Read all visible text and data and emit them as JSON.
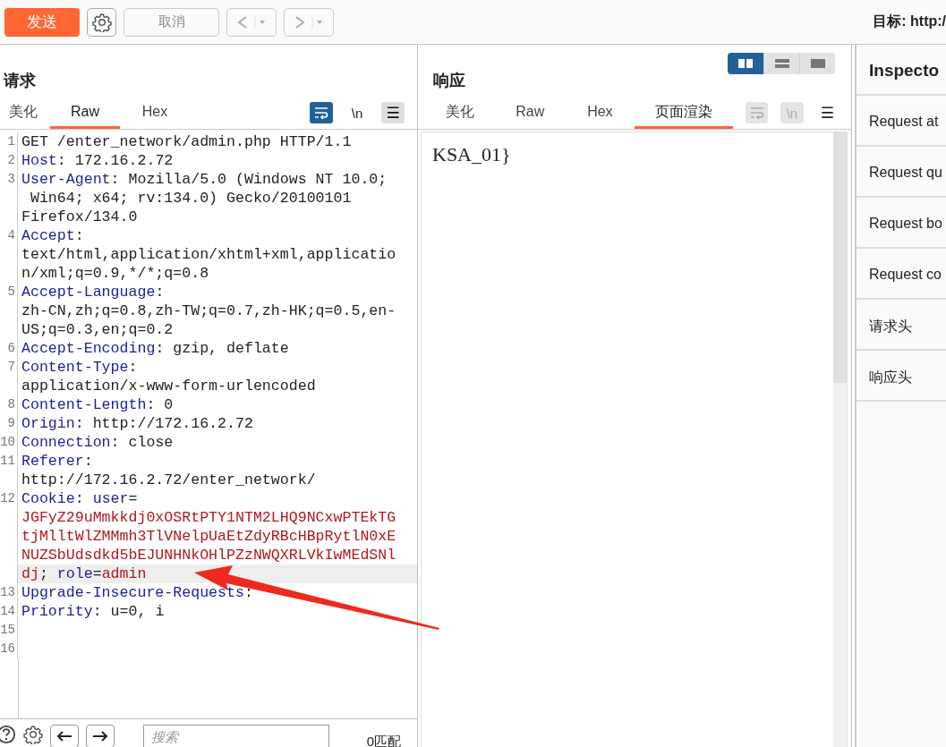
{
  "toolbar": {
    "send_button": "发送",
    "cancel_button": "取消",
    "target": "目标: http:/"
  },
  "request": {
    "title": "请求",
    "tabs": [
      {
        "label": "美化",
        "selected": false
      },
      {
        "label": "Raw",
        "selected": true
      },
      {
        "label": "Hex",
        "selected": false
      }
    ],
    "tools": [
      {
        "kind": "wrap",
        "on": true
      },
      {
        "kind": "newline",
        "text": "\\n",
        "on": false
      },
      {
        "kind": "menu",
        "text": "☰",
        "on": true
      }
    ],
    "lines": [
      {
        "number": "1",
        "rows": [
          {
            "highlighted": false,
            "spans": [
              {
                "kind": "plain",
                "text": "GET /enter_network/admin.php HTTP/1.1"
              }
            ]
          }
        ]
      },
      {
        "number": "2",
        "rows": [
          {
            "highlighted": false,
            "spans": [
              {
                "kind": "key",
                "text": "Host"
              },
              {
                "kind": "plain",
                "text": ": 172.16.2.72"
              }
            ]
          }
        ]
      },
      {
        "number": "3",
        "rows": [
          {
            "highlighted": false,
            "spans": [
              {
                "kind": "key",
                "text": "User-Agent"
              },
              {
                "kind": "plain",
                "text": ": Mozilla/5.0 (Windows NT 10.0;"
              }
            ]
          },
          {
            "highlighted": false,
            "spans": [
              {
                "kind": "plain",
                "text": " Win64; x64; rv:134.0) Gecko/20100101"
              }
            ]
          },
          {
            "highlighted": false,
            "spans": [
              {
                "kind": "plain",
                "text": "Firefox/134.0"
              }
            ]
          }
        ]
      },
      {
        "number": "4",
        "rows": [
          {
            "highlighted": false,
            "spans": [
              {
                "kind": "key",
                "text": "Accept"
              },
              {
                "kind": "plain",
                "text": ":"
              }
            ]
          },
          {
            "highlighted": false,
            "spans": [
              {
                "kind": "plain",
                "text": "text/html,application/xhtml+xml,applicatio"
              }
            ]
          },
          {
            "highlighted": false,
            "spans": [
              {
                "kind": "plain",
                "text": "n/xml;q=0.9,*/*;q=0.8"
              }
            ]
          }
        ]
      },
      {
        "number": "5",
        "rows": [
          {
            "highlighted": false,
            "spans": [
              {
                "kind": "key",
                "text": "Accept-Language"
              },
              {
                "kind": "plain",
                "text": ":"
              }
            ]
          },
          {
            "highlighted": false,
            "spans": [
              {
                "kind": "plain",
                "text": "zh-CN,zh;q=0.8,zh-TW;q=0.7,zh-HK;q=0.5,en-"
              }
            ]
          },
          {
            "highlighted": false,
            "spans": [
              {
                "kind": "plain",
                "text": "US;q=0.3,en;q=0.2"
              }
            ]
          }
        ]
      },
      {
        "number": "6",
        "rows": [
          {
            "highlighted": false,
            "spans": [
              {
                "kind": "key",
                "text": "Accept-Encoding"
              },
              {
                "kind": "plain",
                "text": ": gzip, deflate"
              }
            ]
          }
        ]
      },
      {
        "number": "7",
        "rows": [
          {
            "highlighted": false,
            "spans": [
              {
                "kind": "key",
                "text": "Content-Type"
              },
              {
                "kind": "plain",
                "text": ":"
              }
            ]
          },
          {
            "highlighted": false,
            "spans": [
              {
                "kind": "plain",
                "text": "application/x-www-form-urlencoded"
              }
            ]
          }
        ]
      },
      {
        "number": "8",
        "rows": [
          {
            "highlighted": false,
            "spans": [
              {
                "kind": "key",
                "text": "Content-Length"
              },
              {
                "kind": "plain",
                "text": ": 0"
              }
            ]
          }
        ]
      },
      {
        "number": "9",
        "rows": [
          {
            "highlighted": false,
            "spans": [
              {
                "kind": "key",
                "text": "Origin"
              },
              {
                "kind": "plain",
                "text": ": http://172.16.2.72"
              }
            ]
          }
        ]
      },
      {
        "number": "10",
        "rows": [
          {
            "highlighted": false,
            "spans": [
              {
                "kind": "key",
                "text": "Connection"
              },
              {
                "kind": "plain",
                "text": ": close"
              }
            ]
          }
        ]
      },
      {
        "number": "11",
        "rows": [
          {
            "highlighted": false,
            "spans": [
              {
                "kind": "key",
                "text": "Referer"
              },
              {
                "kind": "plain",
                "text": ":"
              }
            ]
          },
          {
            "highlighted": false,
            "spans": [
              {
                "kind": "plain",
                "text": "http://172.16.2.72/enter_network/"
              }
            ]
          }
        ]
      },
      {
        "number": "12",
        "rows": [
          {
            "highlighted": false,
            "spans": [
              {
                "kind": "key",
                "text": "Cookie"
              },
              {
                "kind": "plain",
                "text": ": "
              },
              {
                "kind": "key",
                "text": "user"
              },
              {
                "kind": "plain",
                "text": "="
              }
            ]
          },
          {
            "highlighted": false,
            "spans": [
              {
                "kind": "cookie",
                "text": "JGFyZ29uMmkkdj0xOSRtPTY1NTM2LHQ9NCxwPTEkTG"
              }
            ]
          },
          {
            "highlighted": false,
            "spans": [
              {
                "kind": "cookie",
                "text": "tjMlltWlZMMmh3TlVNelpUaEtZdyRBcHBpRytlN0xE"
              }
            ]
          },
          {
            "highlighted": false,
            "spans": [
              {
                "kind": "cookie",
                "text": "NUZSbUdsdkd5bEJUNHNkOHlPZzNWQXRLVkIwMEdSNl"
              }
            ]
          },
          {
            "highlighted": true,
            "spans": [
              {
                "kind": "cookie",
                "text": "dj"
              },
              {
                "kind": "plain",
                "text": "; "
              },
              {
                "kind": "key",
                "text": "role"
              },
              {
                "kind": "plain",
                "text": "="
              },
              {
                "kind": "cookie",
                "text": "admin"
              }
            ]
          }
        ]
      },
      {
        "number": "13",
        "rows": [
          {
            "highlighted": false,
            "spans": [
              {
                "kind": "key",
                "text": "Upgrade-Insecure-Requests"
              },
              {
                "kind": "plain",
                "text": ":"
              }
            ]
          }
        ]
      },
      {
        "number": "14",
        "rows": [
          {
            "highlighted": false,
            "spans": [
              {
                "kind": "key",
                "text": "Priority"
              },
              {
                "kind": "plain",
                "text": ": u=0, i"
              }
            ]
          }
        ]
      },
      {
        "number": "15"
      },
      {
        "number": "16"
      }
    ],
    "search": {
      "placeholder": "搜索"
    },
    "match_count": "0匹配"
  },
  "response": {
    "title": "响应",
    "views": [
      {
        "kind": "split",
        "selected": true
      },
      {
        "kind": "stacked",
        "selected": false
      },
      {
        "kind": "single",
        "selected": false
      }
    ],
    "tabs": [
      {
        "label": "美化",
        "selected": false
      },
      {
        "label": "Raw",
        "selected": false
      },
      {
        "label": "Hex",
        "selected": false
      },
      {
        "label": "页面渲染",
        "selected": true
      }
    ],
    "tools": [
      {
        "kind": "wrap",
        "disabled": true
      },
      {
        "kind": "newline",
        "text": "\\n",
        "disabled": true
      },
      {
        "kind": "menu",
        "text": "☰",
        "disabled": false
      }
    ],
    "rendered_text": "KSA_01}"
  },
  "inspector": {
    "title": "Inspecto",
    "items": [
      "Request at",
      "Request qu",
      "Request bo",
      "Request co",
      "请求头",
      "响应头"
    ]
  }
}
